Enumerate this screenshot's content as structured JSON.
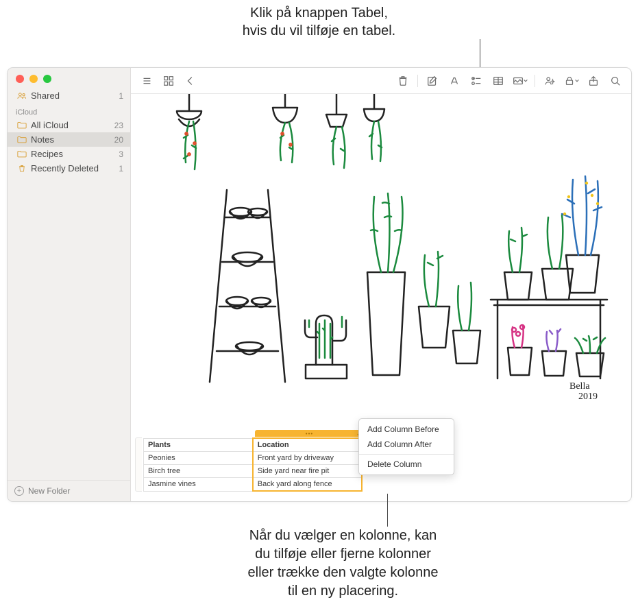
{
  "callouts": {
    "top_line1": "Klik på knappen Tabel,",
    "top_line2": "hvis du vil tilføje en tabel.",
    "bottom_line1": "Når du vælger en kolonne, kan",
    "bottom_line2": "du tilføje eller fjerne kolonner",
    "bottom_line3": "eller trække den valgte kolonne",
    "bottom_line4": "til en ny placering."
  },
  "sidebar": {
    "shared_label": "Shared",
    "shared_count": "1",
    "section_label": "iCloud",
    "items": [
      {
        "label": "All iCloud",
        "count": "23",
        "selected": false
      },
      {
        "label": "Notes",
        "count": "20",
        "selected": true
      },
      {
        "label": "Recipes",
        "count": "3",
        "selected": false
      },
      {
        "label": "Recently Deleted",
        "count": "1",
        "selected": false
      }
    ],
    "new_folder_label": "New Folder"
  },
  "context_menu": {
    "items": [
      "Add Column Before",
      "Add Column After"
    ],
    "bottom": "Delete Column"
  },
  "table": {
    "headers": [
      "Plants",
      "Location"
    ],
    "rows": [
      [
        "Peonies",
        "Front yard by driveway"
      ],
      [
        "Birch tree",
        "Side yard near fire pit"
      ],
      [
        "Jasmine vines",
        "Back yard along fence"
      ]
    ]
  },
  "signature": {
    "name": "Bella",
    "year": "2019"
  },
  "icons": {
    "folder": "folder-icon",
    "people": "people-icon",
    "trash": "trash-icon",
    "list": "list-icon",
    "grid": "grid-icon",
    "back": "back-icon",
    "delete": "trash-icon",
    "compose": "compose-icon",
    "font": "font-icon",
    "checklist": "checklist-icon",
    "table": "table-icon",
    "media": "media-icon",
    "link": "link-icon",
    "lock": "lock-icon",
    "share": "share-icon",
    "search": "search-icon"
  }
}
